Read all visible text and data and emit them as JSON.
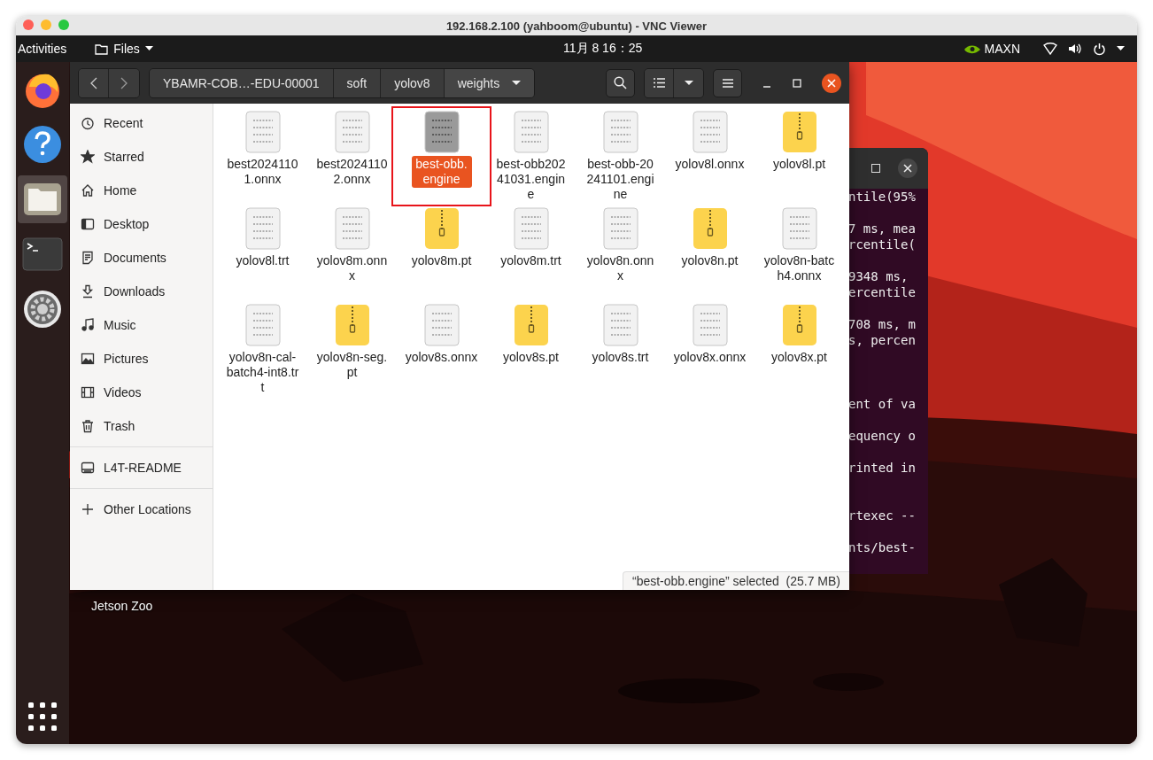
{
  "viewer": {
    "title": "192.168.2.100 (yahboom@ubuntu) - VNC Viewer"
  },
  "top_bar": {
    "activities": "Activities",
    "app_menu": "Files",
    "clock": "11月 8  16：25",
    "indicator": "MAXN"
  },
  "dock": {
    "items": [
      {
        "kind": "firefox",
        "selected": false
      },
      {
        "kind": "help",
        "selected": false
      },
      {
        "kind": "files",
        "selected": true
      },
      {
        "kind": "terminal",
        "selected": false
      },
      {
        "kind": "settings",
        "selected": false
      }
    ]
  },
  "desktop_icons": [
    {
      "label": "Jetson Zoo"
    }
  ],
  "files": {
    "path": [
      {
        "label": "YBAMR-COB…-EDU-00001",
        "selected": false
      },
      {
        "label": "soft",
        "selected": false
      },
      {
        "label": "yolov8",
        "selected": false
      },
      {
        "label": "weights",
        "selected": true
      }
    ],
    "sidebar": {
      "places": [
        {
          "label": "Recent"
        },
        {
          "label": "Starred"
        },
        {
          "label": "Home"
        },
        {
          "label": "Desktop"
        },
        {
          "label": "Documents"
        },
        {
          "label": "Downloads"
        },
        {
          "label": "Music"
        },
        {
          "label": "Pictures"
        },
        {
          "label": "Videos"
        },
        {
          "label": "Trash"
        }
      ],
      "devices": [
        {
          "label": "L4T-README"
        }
      ],
      "other": {
        "label": "Other Locations"
      }
    },
    "items": [
      {
        "name": "best20241101.onnx",
        "kind": "binary",
        "selected": false,
        "annotated": false
      },
      {
        "name": "best20241102.onnx",
        "kind": "binary",
        "selected": false,
        "annotated": false
      },
      {
        "name": "best-obb.engine",
        "kind": "binary",
        "selected": true,
        "annotated": true
      },
      {
        "name": "best-obb20241031.engine",
        "kind": "binary",
        "selected": false,
        "annotated": false
      },
      {
        "name": "best-obb-20241101.engine",
        "kind": "binary",
        "selected": false,
        "annotated": false
      },
      {
        "name": "yolov8l.onnx",
        "kind": "binary",
        "selected": false,
        "annotated": false
      },
      {
        "name": "yolov8l.pt",
        "kind": "archive",
        "selected": false,
        "annotated": false
      },
      {
        "name": "yolov8l.trt",
        "kind": "binary",
        "selected": false,
        "annotated": false
      },
      {
        "name": "yolov8m.onnx",
        "kind": "binary",
        "selected": false,
        "annotated": false
      },
      {
        "name": "yolov8m.pt",
        "kind": "archive",
        "selected": false,
        "annotated": false
      },
      {
        "name": "yolov8m.trt",
        "kind": "binary",
        "selected": false,
        "annotated": false
      },
      {
        "name": "yolov8n.onnx",
        "kind": "binary",
        "selected": false,
        "annotated": false
      },
      {
        "name": "yolov8n.pt",
        "kind": "archive",
        "selected": false,
        "annotated": false
      },
      {
        "name": "yolov8n-batch4.onnx",
        "kind": "binary",
        "selected": false,
        "annotated": false
      },
      {
        "name": "yolov8n-cal-batch4-int8.trt",
        "kind": "binary",
        "selected": false,
        "annotated": false
      },
      {
        "name": "yolov8n-seg.pt",
        "kind": "archive",
        "selected": false,
        "annotated": false
      },
      {
        "name": "yolov8s.onnx",
        "kind": "binary",
        "selected": false,
        "annotated": false
      },
      {
        "name": "yolov8s.pt",
        "kind": "archive",
        "selected": false,
        "annotated": false
      },
      {
        "name": "yolov8s.trt",
        "kind": "binary",
        "selected": false,
        "annotated": false
      },
      {
        "name": "yolov8x.onnx",
        "kind": "binary",
        "selected": false,
        "annotated": false
      },
      {
        "name": "yolov8x.pt",
        "kind": "archive",
        "selected": false,
        "annotated": false
      }
    ],
    "status": "“best-obb.engine” selected  (25.7 MB)"
  },
  "terminal": {
    "paragraphs": [
      [
        "ntile(95%"
      ],
      [
        "7 ms, mea",
        "rcentile("
      ],
      [
        "9348 ms,",
        "ercentile"
      ],
      [
        "708 ms, m",
        "s, percen"
      ],
      [
        "ent of va"
      ],
      [
        "equency o"
      ],
      [
        "rinted in"
      ],
      [
        "rtexec --"
      ],
      [
        "nts/best-"
      ]
    ]
  }
}
